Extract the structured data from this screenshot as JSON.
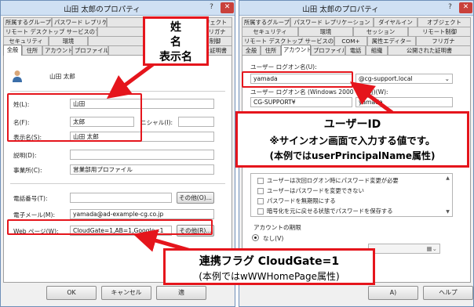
{
  "left": {
    "title": "山田 太郎のプロパティ",
    "tab_rows": [
      [
        "所属するグループ",
        "パスワード レプリケー",
        "",
        "",
        "ブジェクト"
      ],
      [
        "リモート デスクトップ サービスのプロファイル",
        "",
        "",
        "",
        "フリガナ"
      ],
      [
        "セキュリティ",
        "環境",
        "",
        "",
        "制御"
      ],
      [
        "全般",
        "住所",
        "アカウント",
        "プロファイル",
        "",
        "れた証明書"
      ]
    ],
    "user_name": "山田 太郎",
    "labels": {
      "last": "姓(L):",
      "first": "名(F):",
      "initials": "ニシャル(I):",
      "display": "表示名(S):",
      "desc": "説明(D):",
      "office": "事業所(C):",
      "phone": "電話番号(T):",
      "email": "電子メール(M):",
      "web": "Web ページ(W):"
    },
    "values": {
      "last": "山田",
      "first": "太郎",
      "initials": "",
      "display": "山田 太郎",
      "desc": "",
      "office": "営業部用プロファイル",
      "phone": "",
      "email": "yamada@ad-example-cg.co.jp",
      "web": "CloudGate=1,AB=1,Google=1"
    },
    "other_button": "その他(O)...",
    "other_button_r": "その他(R)...",
    "ok": "OK",
    "cancel": "キャンセル",
    "apply": "適"
  },
  "right": {
    "title": "山田 太郎のプロパティ",
    "tab_rows": [
      [
        "所属するグループ",
        "パスワード レプリケーション",
        "ダイヤルイン",
        "オブジェクト"
      ],
      [
        "セキュリティ",
        "環境",
        "セッション",
        "リモート制御"
      ],
      [
        "リモート デスクトップ サービスのプロファイル",
        "COM+",
        "属性エディター",
        "フリガナ"
      ],
      [
        "全般",
        "住所",
        "アカウント",
        "プロファイル",
        "電話",
        "組織",
        "公開された証明書"
      ]
    ],
    "logon_label": "ユーザー ログオン名(U):",
    "logon_value": "yamada",
    "domain_value": "@cg-support.local",
    "pre2000_label": "ユーザー ログオン名 (Windows 2000 より前)(W):",
    "pre2000_domain": "CG-SUPPORT¥",
    "pre2000_user": "yamada",
    "options": [
      "ユーザーは次回ログオン時にパスワード変更が必要",
      "ユーザーはパスワードを変更できない",
      "パスワードを無期限にする",
      "暗号化を元に戻せる状態でパスワードを保存する"
    ],
    "expiry_label": "アカウントの期限",
    "never_label": "なし(V)",
    "apply": "A)",
    "help": "ヘルプ"
  },
  "callouts": {
    "name_lines": [
      "姓",
      "名",
      "表示名"
    ],
    "userid_lines": [
      "ユーザーID",
      "※サインオン画面で入力する値です。",
      "(本例ではuserPrincipalName属性)"
    ],
    "flag_lines": [
      "連携フラグ CloudGate=1",
      "(本例ではwWWHomePage属性)"
    ]
  },
  "colors": {
    "highlight": "#e5151c",
    "title_bg": "#cfe0f3"
  }
}
